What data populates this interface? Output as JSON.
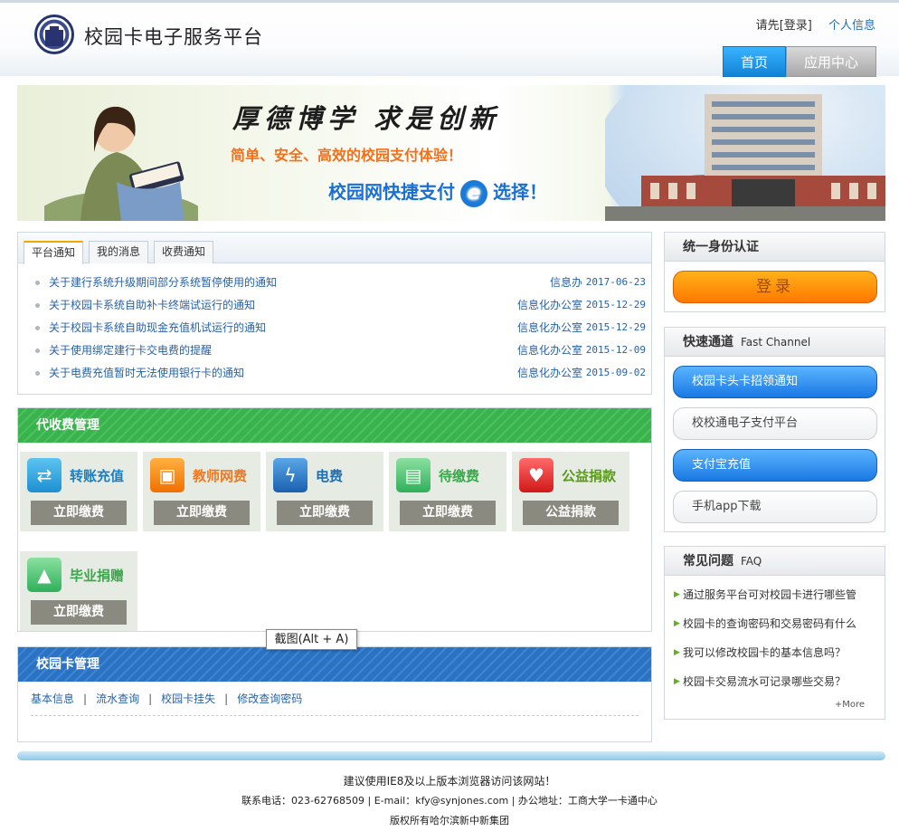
{
  "header": {
    "title": "校园卡电子服务平台",
    "login_prefix": "请先",
    "login_label": "[登录]",
    "profile_label": "个人信息",
    "tabs": [
      {
        "label": "首页"
      },
      {
        "label": "应用中心"
      }
    ]
  },
  "banner": {
    "slogan": "厚德博学 求是创新",
    "subtitle": "简单、安全、高效的校园支付体验！",
    "pay_text": "校园网快捷支付",
    "pay_text2": "选择！"
  },
  "notices": {
    "tabs": [
      "平台通知",
      "我的消息",
      "收费通知"
    ],
    "items": [
      {
        "title": "关于建行系统升级期间部分系统暂停使用的通知",
        "dept": "信息办",
        "date": "2017-06-23"
      },
      {
        "title": "关于校园卡系统自助补卡终端试运行的通知",
        "dept": "信息化办公室",
        "date": "2015-12-29"
      },
      {
        "title": "关于校园卡系统自助现金充值机试运行的通知",
        "dept": "信息化办公室",
        "date": "2015-12-29"
      },
      {
        "title": "关于使用绑定建行卡交电费的提醒",
        "dept": "信息化办公室",
        "date": "2015-12-09"
      },
      {
        "title": "关于电费充值暂时无法使用银行卡的通知",
        "dept": "信息化办公室",
        "date": "2015-09-02"
      }
    ]
  },
  "services": {
    "title": "代收费管理",
    "items": [
      {
        "name": "转账充值",
        "button": "立即缴费",
        "color": "#1a7fc4",
        "icon": "transfer-icon"
      },
      {
        "name": "教师网费",
        "button": "立即缴费",
        "color": "#f07820",
        "icon": "computer-icon"
      },
      {
        "name": "电费",
        "button": "立即缴费",
        "color": "#1a6fb8",
        "icon": "lightning-icon"
      },
      {
        "name": "待缴费",
        "button": "立即缴费",
        "color": "#3aa84a",
        "icon": "wallet-icon"
      },
      {
        "name": "公益捐款",
        "button": "公益捐款",
        "color": "#d9302a",
        "icon": "heart-icon"
      },
      {
        "name": "毕业捐赠",
        "button": "立即缴费",
        "color": "#3aa84a",
        "icon": "graduation-cap-icon"
      }
    ]
  },
  "card_mgmt": {
    "title": "校园卡管理",
    "links": [
      "基本信息",
      "流水查询",
      "校园卡挂失",
      "修改查询密码"
    ]
  },
  "auth": {
    "title": "统一身份认证",
    "login_button": "登录"
  },
  "fast_channel": {
    "title": "快速通道",
    "subtitle": "Fast Channel",
    "items": [
      {
        "label": "校园卡头卡招领通知",
        "style": "blue"
      },
      {
        "label": "校校通电子支付平台",
        "style": "gray"
      },
      {
        "label": "支付宝充值",
        "style": "blue"
      },
      {
        "label": "手机app下载",
        "style": "gray"
      }
    ]
  },
  "faq": {
    "title": "常见问题",
    "subtitle": "FAQ",
    "items": [
      "通过服务平台可对校园卡进行哪些管",
      "校园卡的查询密码和交易密码有什么",
      "我可以修改校园卡的基本信息吗？",
      "校园卡交易流水可记录哪些交易？"
    ],
    "more": "More"
  },
  "footer": {
    "line1": "建议使用IE8及以上版本浏览器访问该网站！",
    "line2": "联系电话：023-62768509 | E-mail：kfy@synjones.com | 办公地址：工商大学一卡通中心",
    "line3": "版权所有哈尔滨新中新集团"
  },
  "tooltip": "截图(Alt + A)"
}
